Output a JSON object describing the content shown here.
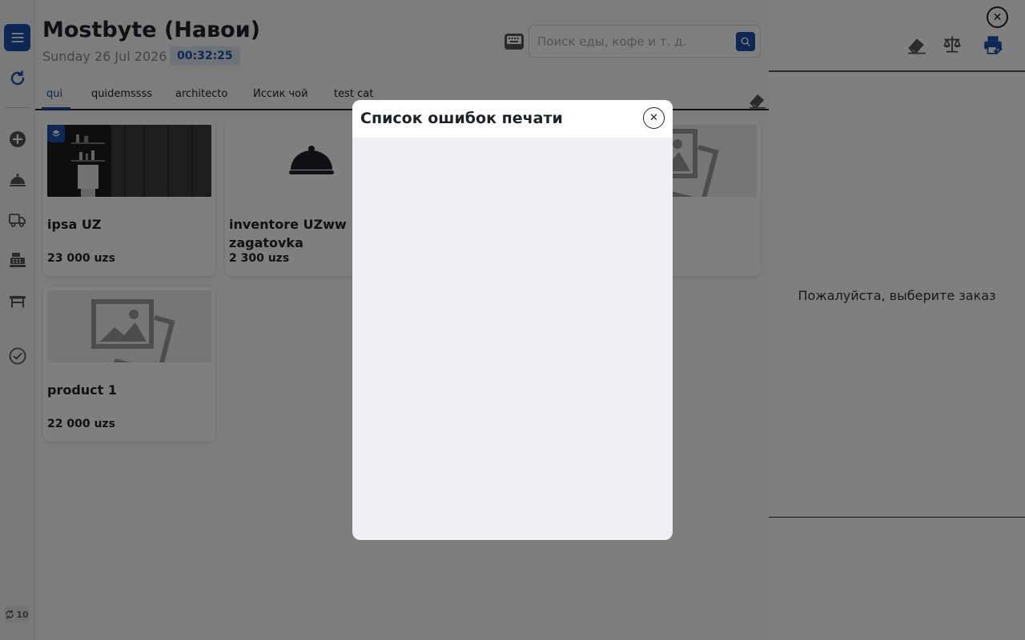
{
  "header": {
    "title": "Mostbyte (Навои)",
    "date": "Sunday 26 Jul 2026",
    "time": "00:32:25"
  },
  "search": {
    "placeholder": "Поиск еды, кофе и т. д."
  },
  "tabs": [
    {
      "label": "qui",
      "active": true
    },
    {
      "label": "quidemssss"
    },
    {
      "label": "architecto"
    },
    {
      "label": "Иссик чой"
    },
    {
      "label": "test cat"
    }
  ],
  "products": [
    {
      "name": "ipsa UZ",
      "price": "23 000 uzs",
      "image": "photo"
    },
    {
      "name": "inventore UZww zagatovka",
      "price": "2 300 uzs",
      "image": "cloche-icon"
    },
    {
      "name": "",
      "price": "",
      "image": "placeholder-image-icon"
    },
    {
      "name": "product 1",
      "price": "22 000 uzs",
      "image": "placeholder-image-icon"
    }
  ],
  "sidebar": {
    "items": [
      "menu-icon",
      "refresh-icon",
      "plus-circle-icon",
      "cloche-icon",
      "truck-icon",
      "cash-register-icon",
      "table-icon",
      "check-circle-icon"
    ],
    "sync_count": "10"
  },
  "right_panel": {
    "empty_text": "Пожалуйста, выберите заказ",
    "icons": [
      "eraser-icon",
      "scales-icon",
      "printer-check-icon",
      "close-icon"
    ]
  },
  "modal": {
    "title": "Список ошибок печати",
    "close_icon": "close-icon"
  },
  "colors": {
    "accent": "#1e4fa8",
    "overlay": "rgba(0,0,0,0.5)",
    "modal_body": "#eeeff2"
  }
}
